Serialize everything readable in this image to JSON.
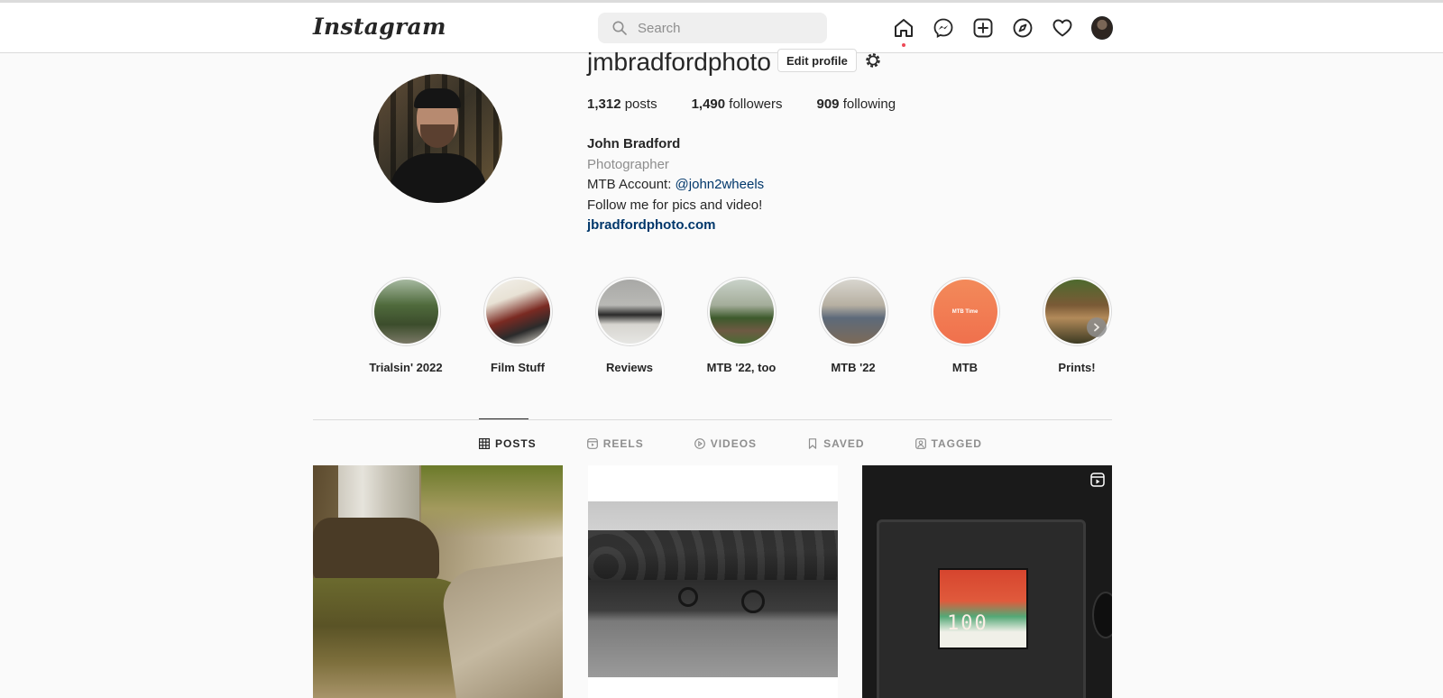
{
  "header": {
    "logo": "Instagram",
    "search_placeholder": "Search",
    "nav_icons": [
      "home-icon",
      "messenger-icon",
      "new-post-icon",
      "explore-icon",
      "activity-heart-icon",
      "profile-avatar"
    ]
  },
  "profile": {
    "username": "jmbradfordphoto",
    "edit_button": "Edit profile",
    "stats": {
      "posts_count": "1,312",
      "posts_label": "posts",
      "followers_count": "1,490",
      "followers_label": "followers",
      "following_count": "909",
      "following_label": "following"
    },
    "bio": {
      "name": "John Bradford",
      "category": "Photographer",
      "line1_prefix": "MTB Account: ",
      "line1_mention": "@john2wheels",
      "line2": "Follow me for pics and video!",
      "link": "jbradfordphoto.com"
    }
  },
  "highlights": [
    {
      "label": "Trialsin' 2022"
    },
    {
      "label": "Film Stuff"
    },
    {
      "label": "Reviews"
    },
    {
      "label": "MTB '22, too"
    },
    {
      "label": "MTB '22"
    },
    {
      "label": "MTB",
      "cover_text": "MTB Time"
    },
    {
      "label": "Prints!"
    }
  ],
  "tabs": [
    {
      "label": "POSTS",
      "active": true
    },
    {
      "label": "REELS",
      "active": false
    },
    {
      "label": "VIDEOS",
      "active": false
    },
    {
      "label": "SAVED",
      "active": false
    },
    {
      "label": "TAGGED",
      "active": false
    }
  ],
  "posts": {
    "post3_film_text": "100"
  },
  "colors": {
    "link": "#00376b",
    "secondary_text": "#8e8e8e",
    "border": "#dbdbdb",
    "notification_dot": "#ed4956",
    "background": "#fafafa"
  }
}
